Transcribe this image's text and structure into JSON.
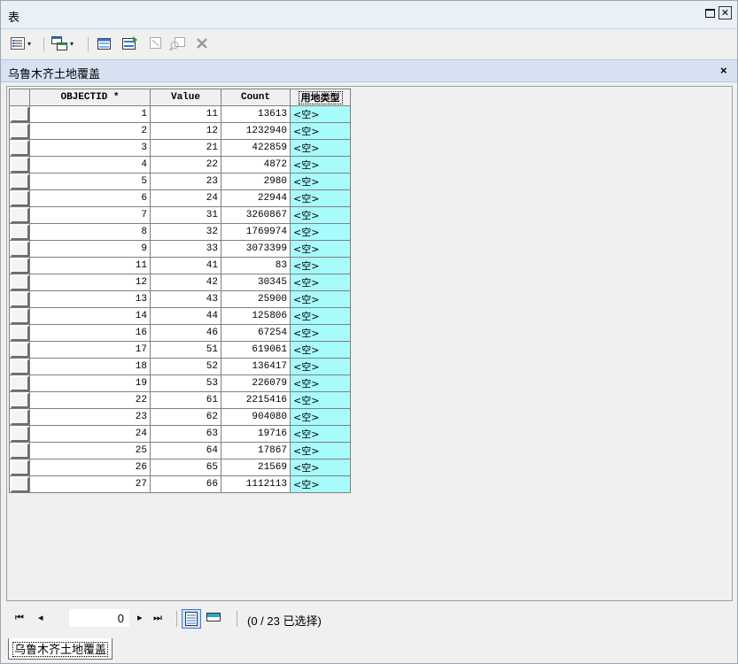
{
  "window": {
    "title": "表",
    "restore_glyph": "restore-icon",
    "close_glyph": "✕"
  },
  "toolbar": {
    "icons": [
      "table-options-icon",
      "related-tables-icon",
      "select-by-attributes-icon",
      "switch-selection-icon",
      "clear-selection-icon",
      "zoom-to-selected-icon",
      "delete-selected-icon"
    ],
    "dropdown_glyph": "▾"
  },
  "tab": {
    "title": "乌鲁木齐土地覆盖",
    "close": "×"
  },
  "grid": {
    "headers": [
      "OBJECTID *",
      "Value",
      "Count",
      "用地类型"
    ],
    "rows": [
      [
        "1",
        "11",
        "13613",
        "<空>"
      ],
      [
        "2",
        "12",
        "1232940",
        "<空>"
      ],
      [
        "3",
        "21",
        "422859",
        "<空>"
      ],
      [
        "4",
        "22",
        "4872",
        "<空>"
      ],
      [
        "5",
        "23",
        "2980",
        "<空>"
      ],
      [
        "6",
        "24",
        "22944",
        "<空>"
      ],
      [
        "7",
        "31",
        "3260867",
        "<空>"
      ],
      [
        "8",
        "32",
        "1769974",
        "<空>"
      ],
      [
        "9",
        "33",
        "3073399",
        "<空>"
      ],
      [
        "11",
        "41",
        "83",
        "<空>"
      ],
      [
        "12",
        "42",
        "30345",
        "<空>"
      ],
      [
        "13",
        "43",
        "25900",
        "<空>"
      ],
      [
        "14",
        "44",
        "125806",
        "<空>"
      ],
      [
        "16",
        "46",
        "67254",
        "<空>"
      ],
      [
        "17",
        "51",
        "619061",
        "<空>"
      ],
      [
        "18",
        "52",
        "136417",
        "<空>"
      ],
      [
        "19",
        "53",
        "226079",
        "<空>"
      ],
      [
        "22",
        "61",
        "2215416",
        "<空>"
      ],
      [
        "23",
        "62",
        "904080",
        "<空>"
      ],
      [
        "24",
        "63",
        "19716",
        "<空>"
      ],
      [
        "25",
        "64",
        "17867",
        "<空>"
      ],
      [
        "26",
        "65",
        "21569",
        "<空>"
      ],
      [
        "27",
        "66",
        "1112113",
        "<空>"
      ]
    ],
    "colors": {
      "null_cell_bg": "#a7fbfb",
      "header_bg": "#f0f0f0"
    }
  },
  "navigator": {
    "first": "⏮",
    "prev": "◂",
    "record": "0",
    "next": "▸",
    "last": "⏭",
    "selection_info": "(0 / 23 已选择)"
  },
  "bottom_tab": {
    "label": "乌鲁木齐土地覆盖"
  }
}
